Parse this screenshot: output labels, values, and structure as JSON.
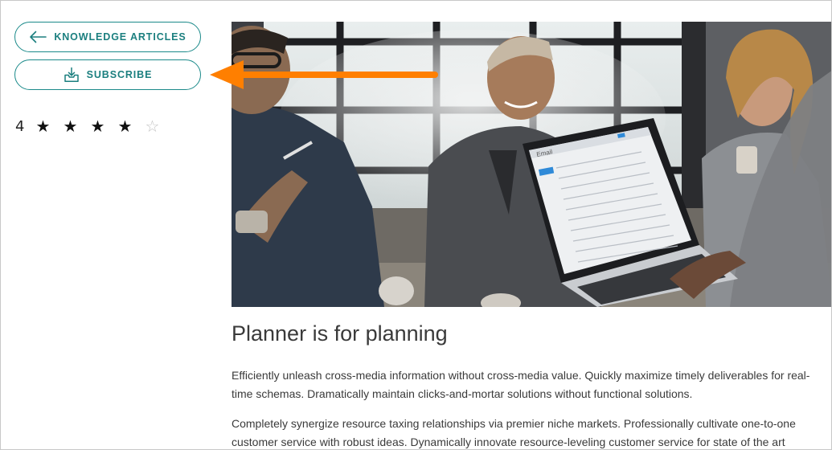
{
  "actions": {
    "knowledge_articles_label": "KNOWLEDGE ARTICLES",
    "subscribe_label": "SUBSCRIBE"
  },
  "rating": {
    "value": "4",
    "stars_filled": 4,
    "stars_total": 5,
    "star_filled_glyph": "★",
    "star_empty_glyph": "☆"
  },
  "hero_image": {
    "laptop_screen_title": "Email"
  },
  "article": {
    "title": "Planner is for planning",
    "paragraphs": [
      "Efficiently unleash cross-media information without cross-media value. Quickly maximize timely deliverables for real-time schemas. Dramatically maintain clicks-and-mortar solutions without functional solutions.",
      "Completely synergize resource taxing relationships via premier niche markets. Professionally cultivate one-to-one customer service with robust ideas. Dynamically innovate resource-leveling customer service for state of the art"
    ]
  },
  "icons": {
    "back": "arrow-left-icon",
    "subscribe": "inbox-download-icon",
    "annotation": "orange-pointer-arrow"
  },
  "colors": {
    "accent": "#1b8a8a",
    "annotation_arrow": "#ff7f00",
    "text": "#3a3a3a"
  }
}
